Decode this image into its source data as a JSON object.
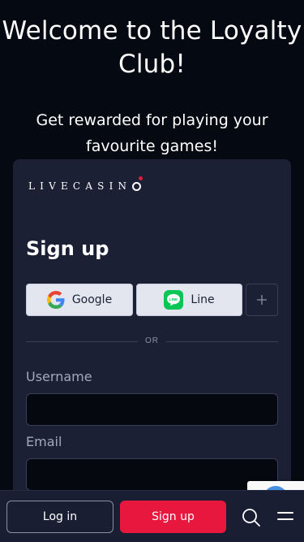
{
  "hero": {
    "title": "Welcome to the Loyalty Club!",
    "subtitle": "Get rewarded for playing your favourite games!"
  },
  "card": {
    "logo_text": "LIVECASIN",
    "logo_icon": "casino-logo-o-icon",
    "signup_title": "Sign up",
    "social": {
      "google_label": "Google",
      "line_label": "Line",
      "more_icon": "plus-icon"
    },
    "divider_text": "OR",
    "fields": {
      "username_label": "Username",
      "username_value": "",
      "email_label": "Email",
      "email_value": ""
    }
  },
  "bottom_bar": {
    "login_label": "Log in",
    "signup_label": "Sign up",
    "search_icon": "search-icon",
    "menu_icon": "hamburger-menu-icon"
  },
  "colors": {
    "background": "#050a12",
    "card": "#1c2035",
    "accent": "#e8173d",
    "line_brand": "#06c755"
  }
}
